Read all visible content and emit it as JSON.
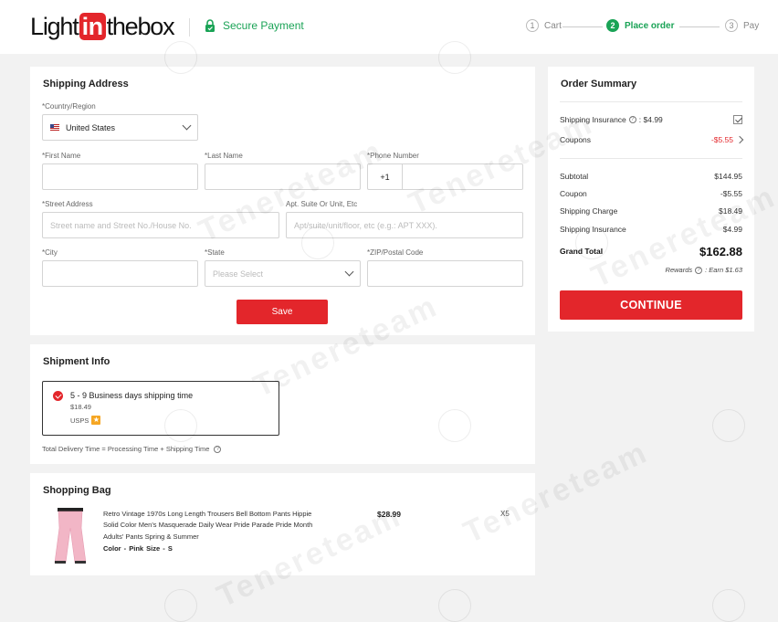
{
  "header": {
    "logo": {
      "light": "Light",
      "in": "in",
      "thebox": "thebox"
    },
    "secure_label": "Secure Payment",
    "steps": [
      {
        "num": "1",
        "label": "Cart"
      },
      {
        "num": "2",
        "label": "Place order"
      },
      {
        "num": "3",
        "label": "Pay"
      }
    ]
  },
  "shipping_address": {
    "title": "Shipping Address",
    "country_label": "*Country/Region",
    "country_value": "United States",
    "first_name_label": "*First Name",
    "last_name_label": "*Last Name",
    "phone_label": "*Phone Number",
    "phone_prefix": "+1",
    "street_label": "*Street Address",
    "street_placeholder": "Street name and Street No./House No.",
    "apt_label": "Apt. Suite Or Unit, Etc",
    "apt_placeholder": "Apt/suite/unit/floor, etc (e.g.: APT XXX).",
    "city_label": "*City",
    "state_label": "*State",
    "state_placeholder": "Please Select",
    "zip_label": "*ZIP/Postal Code",
    "save_label": "Save"
  },
  "shipment_info": {
    "title": "Shipment Info",
    "option_time": "5 - 9 Business days shipping time",
    "option_price": "$18.49",
    "option_carrier": "USPS",
    "delivery_note": "Total Delivery Time = Processing Time + Shipping Time"
  },
  "shopping_bag": {
    "title": "Shopping Bag",
    "items": [
      {
        "name": "Retro Vintage 1970s Long Length Trousers Bell Bottom Pants Hippie Solid Color Men's Masquerade Daily Wear Pride Parade Pride Month Adults' Pants Spring & Summer",
        "attributes": "Color - Pink   Size - S",
        "price": "$28.99",
        "qty": "X5"
      }
    ]
  },
  "order_summary": {
    "title": "Order Summary",
    "insurance_label": "Shipping Insurance",
    "insurance_value": ": $4.99",
    "coupons_label": "Coupons",
    "coupons_value": "-$5.55",
    "rows": [
      {
        "label": "Subtotal",
        "value": "$144.95"
      },
      {
        "label": "Coupon",
        "value": "-$5.55"
      },
      {
        "label": "Shipping Charge",
        "value": "$18.49"
      },
      {
        "label": "Shipping Insurance",
        "value": "$4.99"
      }
    ],
    "grand_total_label": "Grand Total",
    "grand_total_value": "$162.88",
    "rewards_label": "Rewards",
    "rewards_value": ": Earn $1.63",
    "continue_label": "CONTINUE"
  },
  "watermark": "Tenereteam",
  "colors": {
    "brand_red": "#e3262b",
    "success_green": "#1aa356"
  }
}
